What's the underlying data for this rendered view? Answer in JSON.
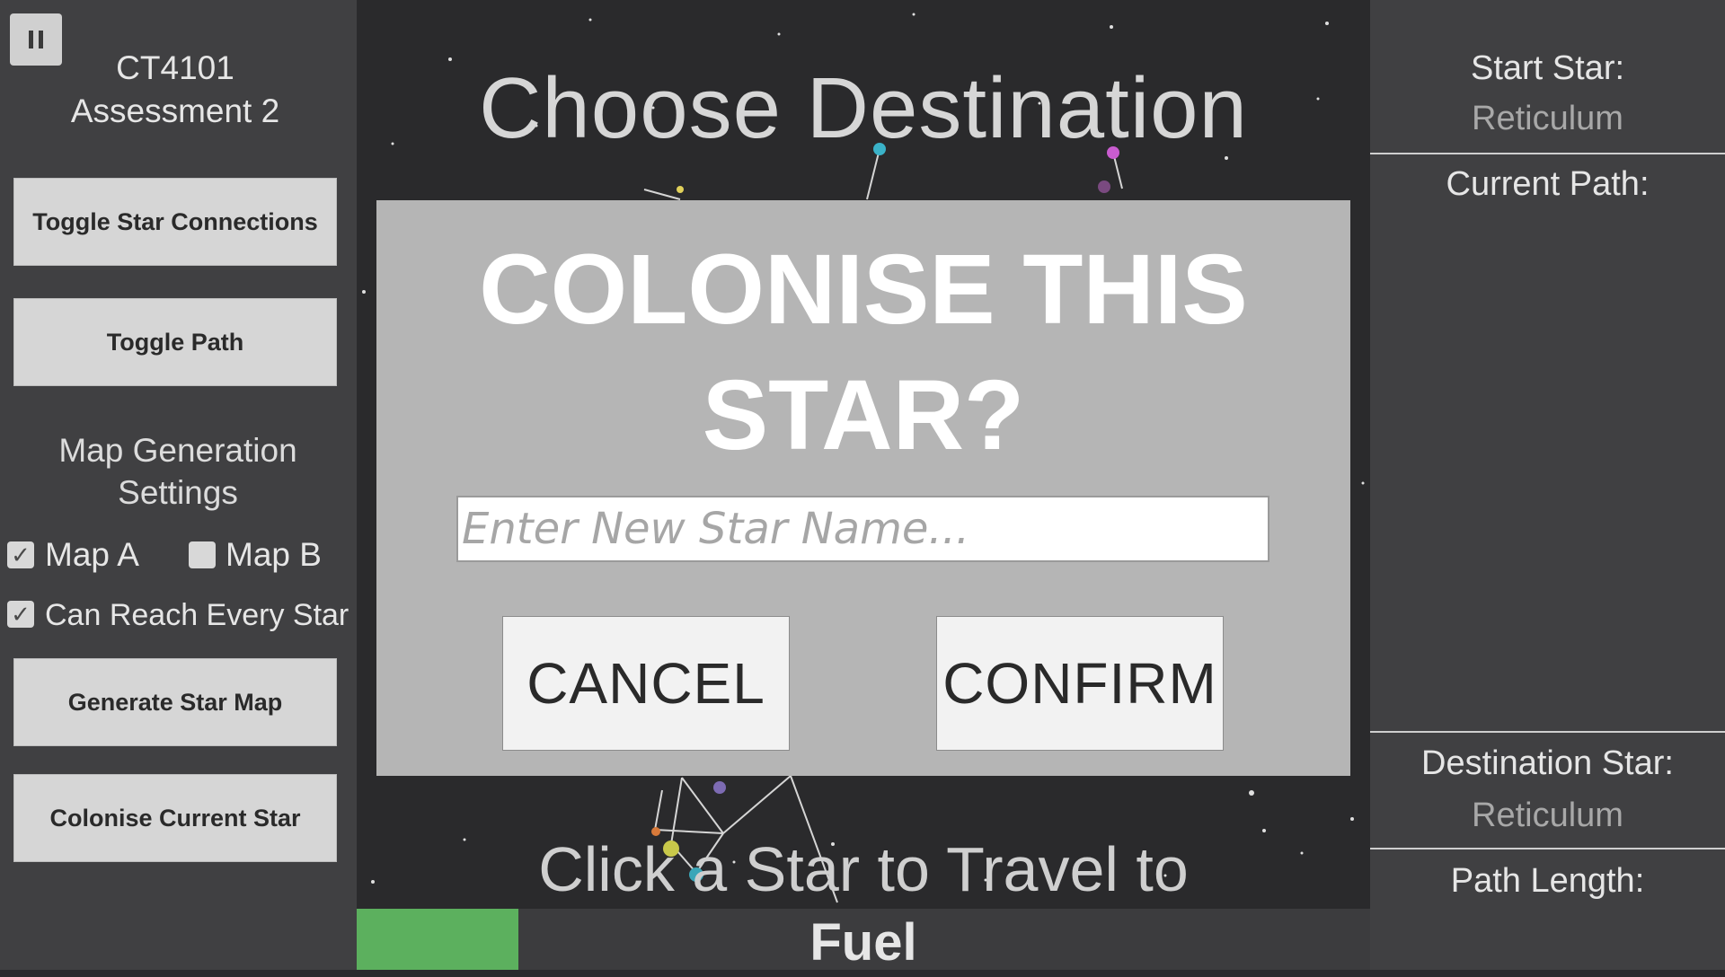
{
  "left_panel": {
    "title_line1": "CT4101",
    "title_line2": "Assessment 2",
    "toggle_connections_label": "Toggle Star Connections",
    "toggle_path_label": "Toggle Path",
    "map_gen_line1": "Map Generation",
    "map_gen_line2": "Settings",
    "map_a_label": "Map A",
    "map_a_checked": true,
    "map_b_label": "Map B",
    "map_b_checked": false,
    "reach_label": "Can Reach Every Star",
    "reach_checked": true,
    "generate_label": "Generate Star Map",
    "colonise_label": "Colonise Current Star",
    "check_glyph": "✓"
  },
  "map": {
    "heading": "Choose Destination",
    "instruction": "Click a Star to Travel to"
  },
  "fuel": {
    "label": "Fuel",
    "level": 0.16,
    "color": "#5cb05e"
  },
  "right_panel": {
    "start_star_label": "Start Star:",
    "start_star_value": "Reticulum",
    "current_path_label": "Current Path:",
    "destination_label": "Destination Star:",
    "destination_value": "Reticulum",
    "path_length_label": "Path Length:"
  },
  "dialog": {
    "title_line1": "COLONISE THIS",
    "title_line2": "STAR?",
    "input_placeholder": "Enter New Star Name...",
    "input_value": "",
    "cancel_label": "CANCEL",
    "confirm_label": "CONFIRM"
  },
  "colors": {
    "panel_bg": "#404042",
    "map_bg": "#2a2a2c",
    "dialog_bg": "#b5b5b5",
    "button_bg": "#d6d6d6"
  }
}
